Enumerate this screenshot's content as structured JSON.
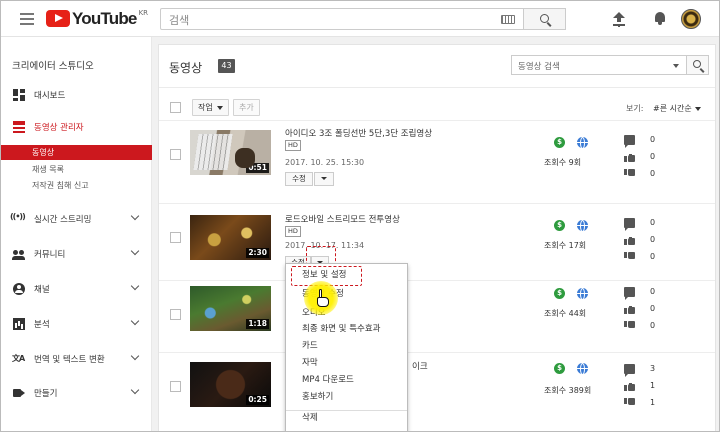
{
  "topbar": {
    "logo_text": "YouTube",
    "logo_region": "KR",
    "search_placeholder": "검색"
  },
  "sidebar": {
    "title": "크리에이터 스튜디오",
    "dashboard": "대시보드",
    "video_manager": "동영상 관리자",
    "sub_items": [
      "동영상",
      "재생 목록",
      "저작권 침해 신고"
    ],
    "live": "실시간 스트리밍",
    "community": "커뮤니티",
    "channel": "채널",
    "analytics": "분석",
    "translation": "번역 및 텍스트 변환",
    "create": "만들기"
  },
  "main": {
    "title": "동영상",
    "count": "43",
    "search_placeholder": "동영상 검색",
    "actions_label": "작업",
    "add_label": "추가",
    "view_label": "보기:",
    "view_value": "#른 시간순"
  },
  "videos": [
    {
      "title": "아이디오 3조 폴딩선반 5단,3단 조립영상",
      "hd": "HD",
      "date": "2017. 10. 25. 15:30",
      "duration": "0:51",
      "edit": "수정",
      "views": "조회수 9회",
      "comments": "0",
      "likes": "0",
      "dislikes": "0"
    },
    {
      "title": "로드오바일 스트리모드 전투영상",
      "hd": "HD",
      "date": "2017. 10. 17. 11:34",
      "duration": "2:30",
      "edit": "수정",
      "views": "조회수 17회",
      "comments": "0",
      "likes": "0",
      "dislikes": "0"
    },
    {
      "title": "",
      "date": "",
      "duration": "1:18",
      "views": "조회수 44회",
      "comments": "0",
      "likes": "0",
      "dislikes": "0"
    },
    {
      "title": "이크",
      "date": "",
      "duration": "0:25",
      "views": "조회수 389회",
      "comments": "3",
      "likes": "1",
      "dislikes": "1"
    }
  ],
  "dropdown": {
    "items": [
      "정보 및 설정",
      "동영상 수정",
      "오디오",
      "최종 화면 및 특수효과",
      "카드",
      "자막",
      "MP4 다운로드",
      "홍보하기",
      "삭제"
    ]
  },
  "colors": {
    "accent": "#cc181e",
    "money": "#2e9b3e",
    "globe": "#3a7bd5"
  }
}
